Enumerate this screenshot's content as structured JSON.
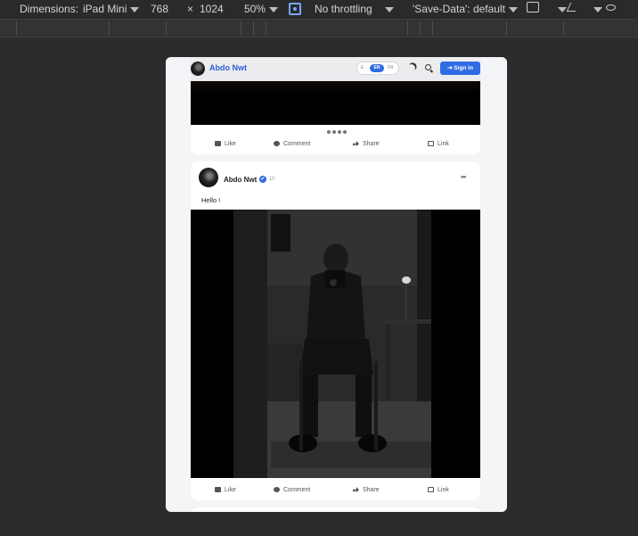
{
  "devtools": {
    "dimensions_label": "Dimensions:",
    "device": "iPad Mini",
    "width": "768",
    "times": "×",
    "height": "1024",
    "zoom": "50%",
    "throttling": "No throttling",
    "save_data": "'Save-Data': default"
  },
  "app": {
    "brand": "Abdo Nwt",
    "languages": [
      "E",
      "EN",
      "FR"
    ],
    "active_language": "EN",
    "signin_label": "Sign in",
    "accent_color": "#2f6be3"
  },
  "post_actions": [
    {
      "icon": "thumbs-up-icon",
      "label": "Like"
    },
    {
      "icon": "comment-icon",
      "label": "Comment"
    },
    {
      "icon": "share-icon",
      "label": "Share"
    },
    {
      "icon": "link-icon",
      "label": "Link"
    }
  ],
  "carousel": {
    "total_dots": 5,
    "active_index": 0
  },
  "post": {
    "author": "Abdo Nwt",
    "verified_mark": "✔",
    "time": "1h",
    "more": "•••",
    "text": "Hello !"
  }
}
